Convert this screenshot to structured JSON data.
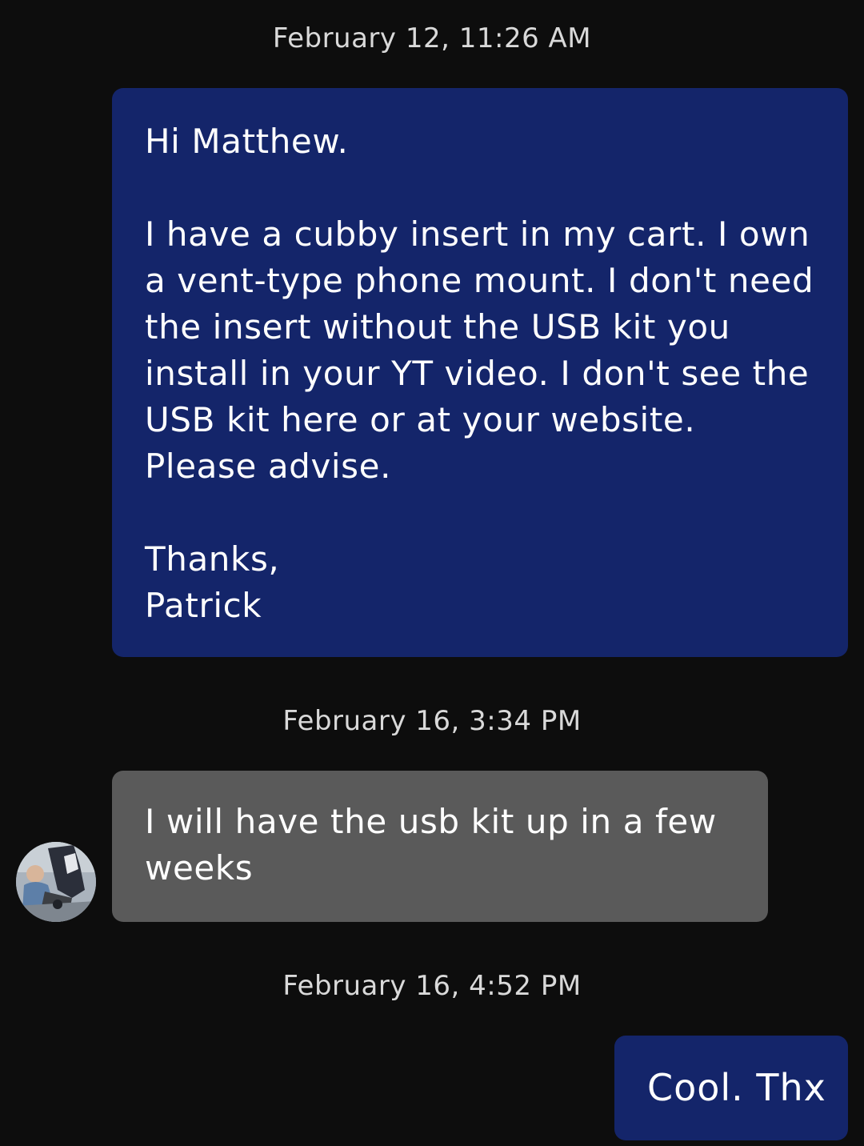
{
  "conversation": {
    "messages": [
      {
        "timestamp": "February 12, 11:26 AM",
        "direction": "outgoing",
        "text": "Hi Matthew.\n\nI have a cubby insert in my cart. I own a vent-type phone mount. I don't need the insert without the USB kit you install in your YT video. I don't see the USB kit here or at your website. Please advise.\n\nThanks,\nPatrick"
      },
      {
        "timestamp": "February 16, 3:34 PM",
        "direction": "incoming",
        "text": "I will have the usb kit up in a few weeks",
        "avatar_icon": "user-avatar-photo"
      },
      {
        "timestamp": "February 16, 4:52 PM",
        "direction": "outgoing",
        "text": "Cool. Thx"
      }
    ]
  },
  "colors": {
    "background": "#0d0d0d",
    "outgoing_bubble": "#14256a",
    "incoming_bubble": "#5a5a5a",
    "timestamp_text": "#d9d9d9",
    "message_text": "#ffffff"
  }
}
